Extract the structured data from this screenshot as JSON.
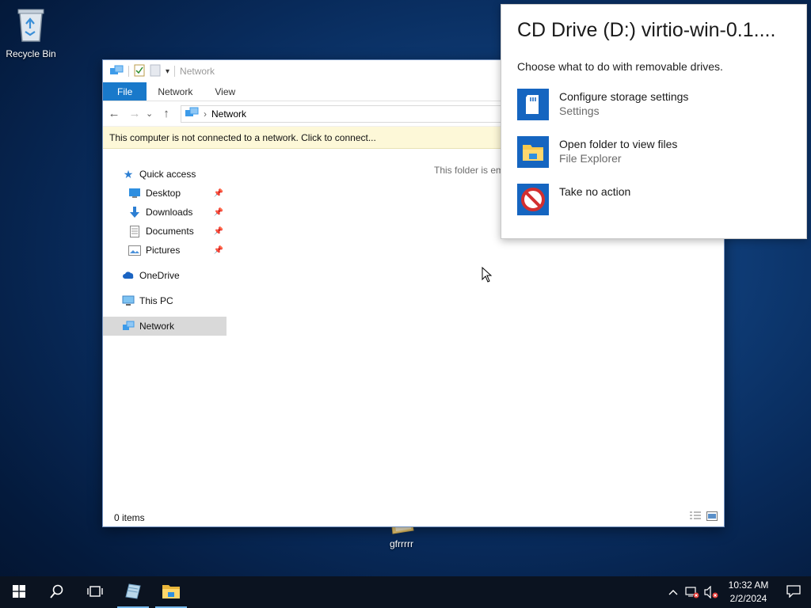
{
  "desktop": {
    "icons": [
      {
        "label": "Recycle Bin",
        "icon": "recycle-bin-icon"
      },
      {
        "label": "gfrrrrr",
        "icon": "folder-shortcut-icon"
      }
    ]
  },
  "explorer": {
    "title": "Network",
    "ribbon_tabs": [
      "File",
      "Network",
      "View"
    ],
    "address": {
      "crumb_separator": "›",
      "location": "Network"
    },
    "nav_buttons": {
      "back": "←",
      "forward": "→",
      "recent": "⌄",
      "up": "↑"
    },
    "info_bar": "This computer is not connected to a network. Click to connect...",
    "navigation": {
      "quick_access": "Quick access",
      "pinned": [
        {
          "label": "Desktop",
          "icon": "desktop-icon"
        },
        {
          "label": "Downloads",
          "icon": "downloads-icon"
        },
        {
          "label": "Documents",
          "icon": "documents-icon"
        },
        {
          "label": "Pictures",
          "icon": "pictures-icon"
        }
      ],
      "onedrive": "OneDrive",
      "this_pc": "This PC",
      "network": "Network"
    },
    "empty_message": "This folder is em",
    "status": "0 items"
  },
  "autoplay": {
    "title": "CD Drive (D:) virtio-win-0.1....",
    "prompt": "Choose what to do with removable drives.",
    "options": [
      {
        "label": "Configure storage settings",
        "sublabel": "Settings",
        "icon": "storage-settings-icon"
      },
      {
        "label": "Open folder to view files",
        "sublabel": "File Explorer",
        "icon": "file-explorer-icon"
      },
      {
        "label": "Take no action",
        "sublabel": "",
        "icon": "no-action-icon"
      }
    ]
  },
  "taskbar": {
    "time": "10:32 AM",
    "date": "2/2/2024",
    "items": [
      "start-icon",
      "search-icon",
      "task-view-icon",
      "server-manager-icon",
      "file-explorer-icon"
    ],
    "tray": [
      "chevron-up-icon",
      "network-disconnected-icon",
      "volume-muted-icon",
      "notification-icon"
    ]
  },
  "colors": {
    "accent": "#1979ca",
    "info_bar": "#fdf8d8",
    "autoplay_tile": "#1565c0",
    "taskbar": "#0b1320"
  }
}
